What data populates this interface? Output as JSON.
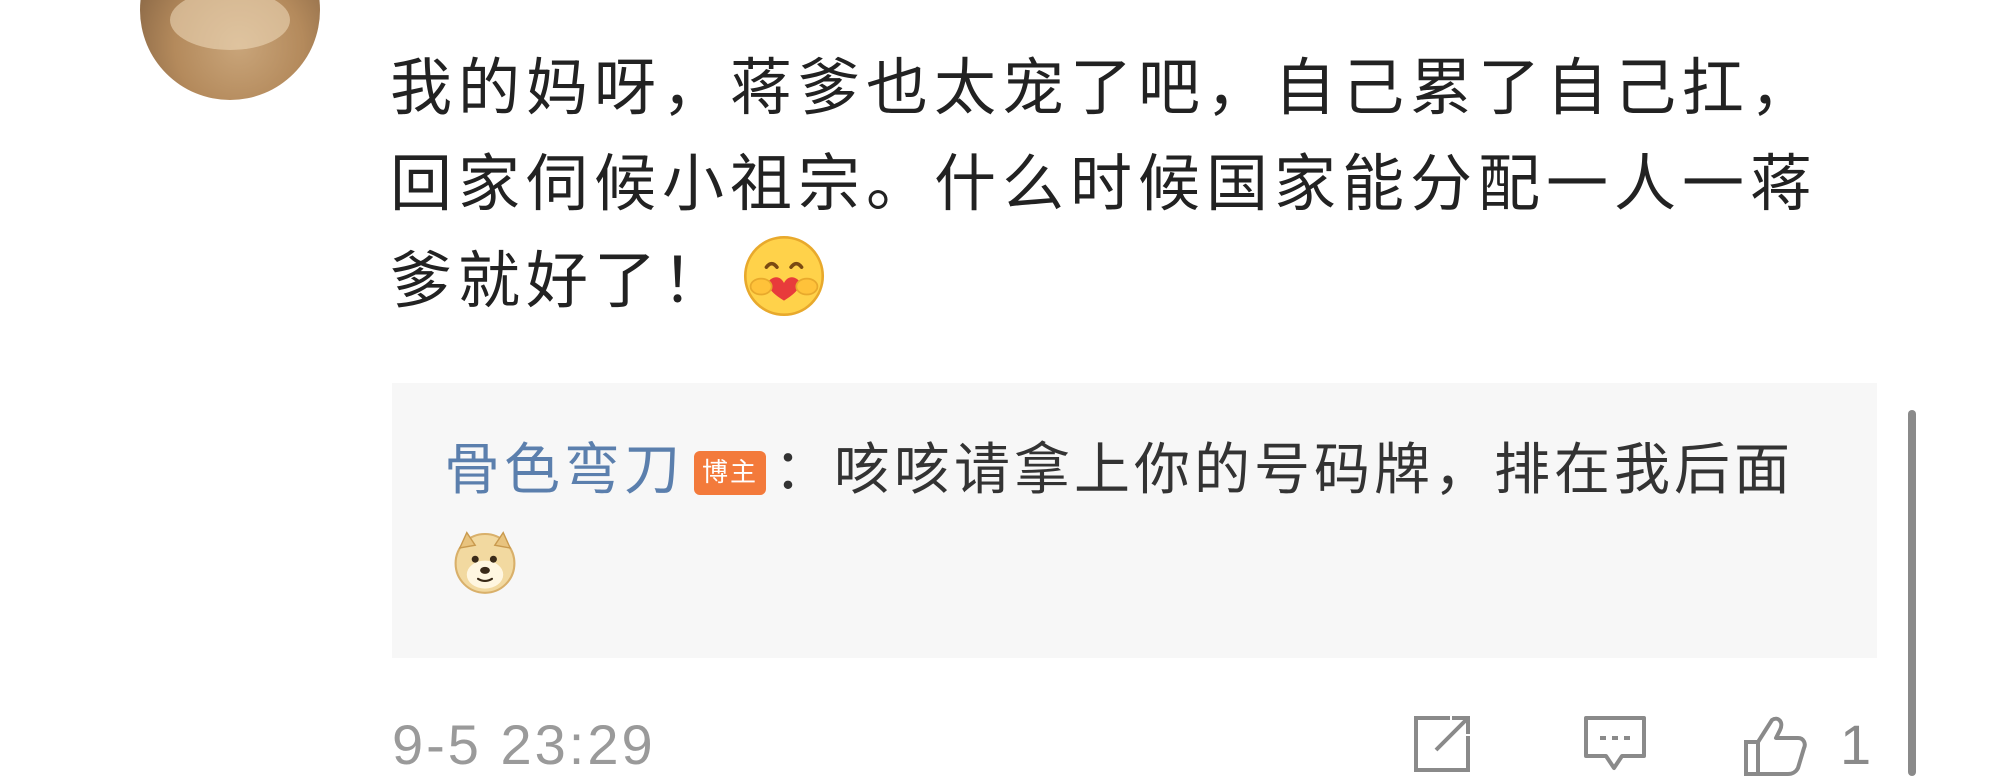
{
  "comment": {
    "text": "我的妈呀，蒋爹也太宠了吧，自己累了自己扛，回家伺候小祖宗。什么时候国家能分配一人一蒋爹就好了！",
    "emoji": "hug-emoji"
  },
  "reply": {
    "user": "骨色弯刀",
    "badge": "博主",
    "separator": "：",
    "text": "咳咳请拿上你的号码牌，排在我后面",
    "emoji": "doge-emoji"
  },
  "meta": {
    "timestamp": "9-5 23:29",
    "like_count": "1"
  },
  "colors": {
    "username": "#5b7fad",
    "badge": "#f37a3b",
    "reply_bg": "#f7f7f7",
    "meta_text": "#9a9a9a"
  },
  "icons": [
    "share-icon",
    "comment-icon",
    "like-icon"
  ]
}
